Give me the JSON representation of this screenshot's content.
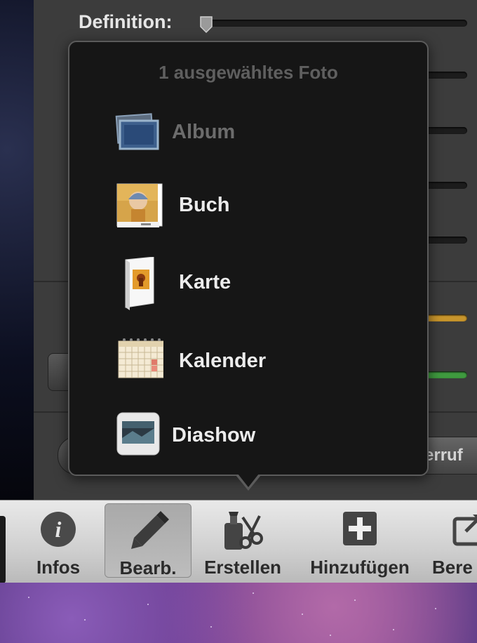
{
  "panel": {
    "definition_label": "Definition:",
    "reset_button_label": "erruf"
  },
  "popover": {
    "title": "1 ausgewähltes Foto",
    "items": [
      {
        "label": "Album",
        "icon": "album-icon",
        "enabled": false
      },
      {
        "label": "Buch",
        "icon": "book-icon",
        "enabled": true
      },
      {
        "label": "Karte",
        "icon": "card-icon",
        "enabled": true
      },
      {
        "label": "Kalender",
        "icon": "calendar-icon",
        "enabled": true
      },
      {
        "label": "Diashow",
        "icon": "slideshow-icon",
        "enabled": true
      }
    ]
  },
  "toolbar": {
    "items": [
      {
        "label": "Infos",
        "icon": "info-icon",
        "active": false
      },
      {
        "label": "Bearb.",
        "icon": "pencil-icon",
        "active": true
      },
      {
        "label": "Erstellen",
        "icon": "create-icon",
        "active": false
      },
      {
        "label": "Hinzufügen",
        "icon": "add-icon",
        "active": false
      },
      {
        "label": "Bere",
        "icon": "share-icon",
        "active": false
      }
    ]
  },
  "colors": {
    "popover_bg": "#161616",
    "slider_orange": "#c8952c",
    "slider_green": "#3f9a3f"
  }
}
